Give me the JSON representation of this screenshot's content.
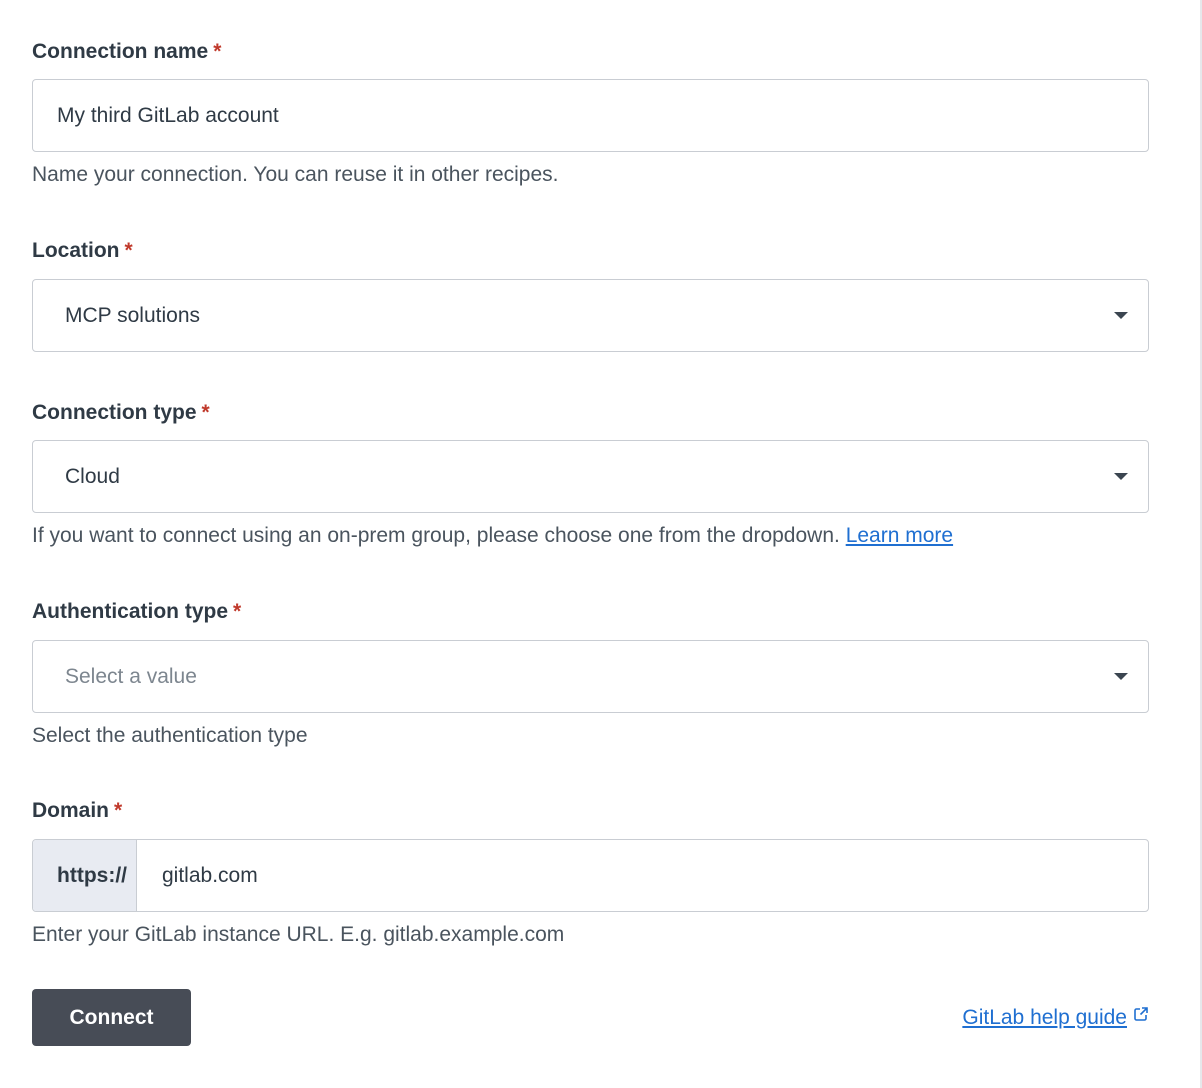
{
  "connection_name": {
    "label": "Connection name",
    "required_mark": "*",
    "value": "My third GitLab account",
    "help": "Name your connection. You can reuse it in other recipes."
  },
  "location": {
    "label": "Location",
    "required_mark": "*",
    "selected": "MCP solutions"
  },
  "connection_type": {
    "label": "Connection type",
    "required_mark": "*",
    "selected": "Cloud",
    "help": "If you want to connect using an on-prem group, please choose one from the dropdown.",
    "help_link": "Learn more"
  },
  "authentication_type": {
    "label": "Authentication type",
    "required_mark": "*",
    "placeholder": "Select a value",
    "help": "Select the authentication type"
  },
  "domain": {
    "label": "Domain",
    "required_mark": "*",
    "prefix": "https://",
    "value": "gitlab.com",
    "help": "Enter your GitLab instance URL. E.g. gitlab.example.com"
  },
  "actions": {
    "connect_label": "Connect",
    "help_guide_label": "GitLab help guide"
  },
  "colors": {
    "required": "#c0392b",
    "link": "#1f6fd1",
    "button_bg": "#474c56",
    "prefix_bg": "#e8ebf2"
  }
}
